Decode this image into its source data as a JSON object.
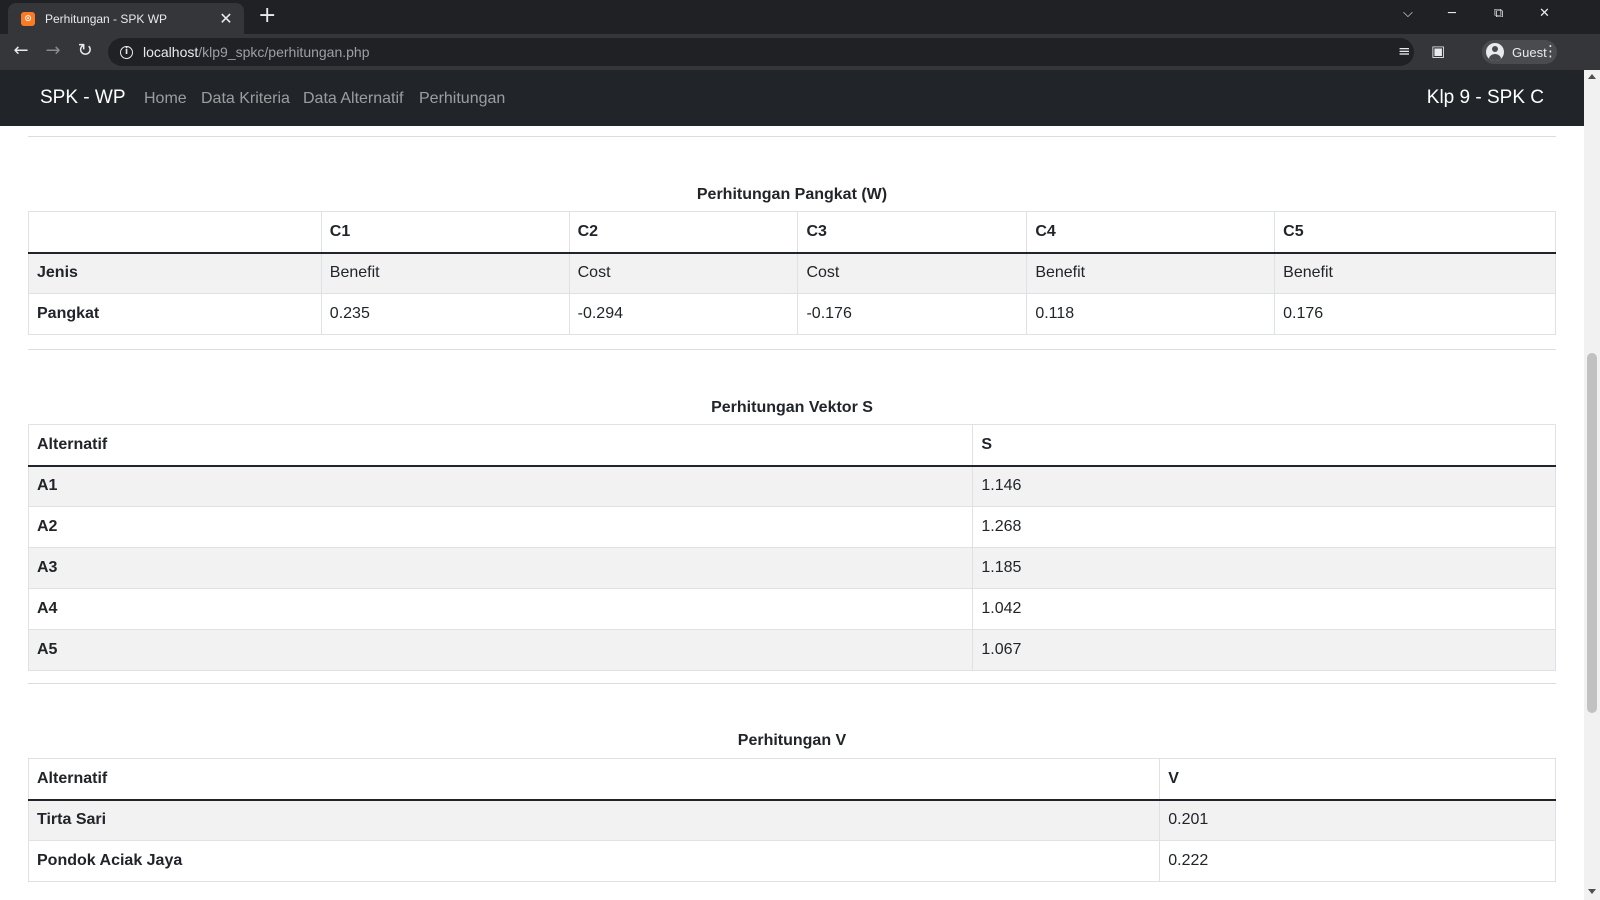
{
  "browser": {
    "tab_title": "Perhitungan - SPK WP",
    "url_host": "localhost",
    "url_path": "/klp9_spkc/perhitungan.php",
    "profile_label": "Guest"
  },
  "navbar": {
    "brand": "SPK - WP",
    "links": [
      "Home",
      "Data Kriteria",
      "Data Alternatif",
      "Perhitungan"
    ],
    "right_text": "Klp 9 - SPK C"
  },
  "pangkat": {
    "title": "Perhitungan Pangkat (W)",
    "headers": [
      "",
      "C1",
      "C2",
      "C3",
      "C4",
      "C5"
    ],
    "rows": [
      {
        "label": "Jenis",
        "values": [
          "Benefit",
          "Cost",
          "Cost",
          "Benefit",
          "Benefit"
        ]
      },
      {
        "label": "Pangkat",
        "values": [
          "0.235",
          "-0.294",
          "-0.176",
          "0.118",
          "0.176"
        ]
      }
    ]
  },
  "vektor_s": {
    "title": "Perhitungan Vektor S",
    "headers": [
      "Alternatif",
      "S"
    ],
    "rows": [
      {
        "label": "A1",
        "value": "1.146"
      },
      {
        "label": "A2",
        "value": "1.268"
      },
      {
        "label": "A3",
        "value": "1.185"
      },
      {
        "label": "A4",
        "value": "1.042"
      },
      {
        "label": "A5",
        "value": "1.067"
      }
    ]
  },
  "vektor_v": {
    "title": "Perhitungan V",
    "headers": [
      "Alternatif",
      "V"
    ],
    "rows": [
      {
        "label": "Tirta Sari",
        "value": "0.201"
      },
      {
        "label": "Pondok Aciak Jaya",
        "value": "0.222"
      }
    ]
  },
  "colors": {
    "navbar_bg": "#212529",
    "stripe_bg": "#f2f2f2",
    "border": "#dee2e6"
  }
}
